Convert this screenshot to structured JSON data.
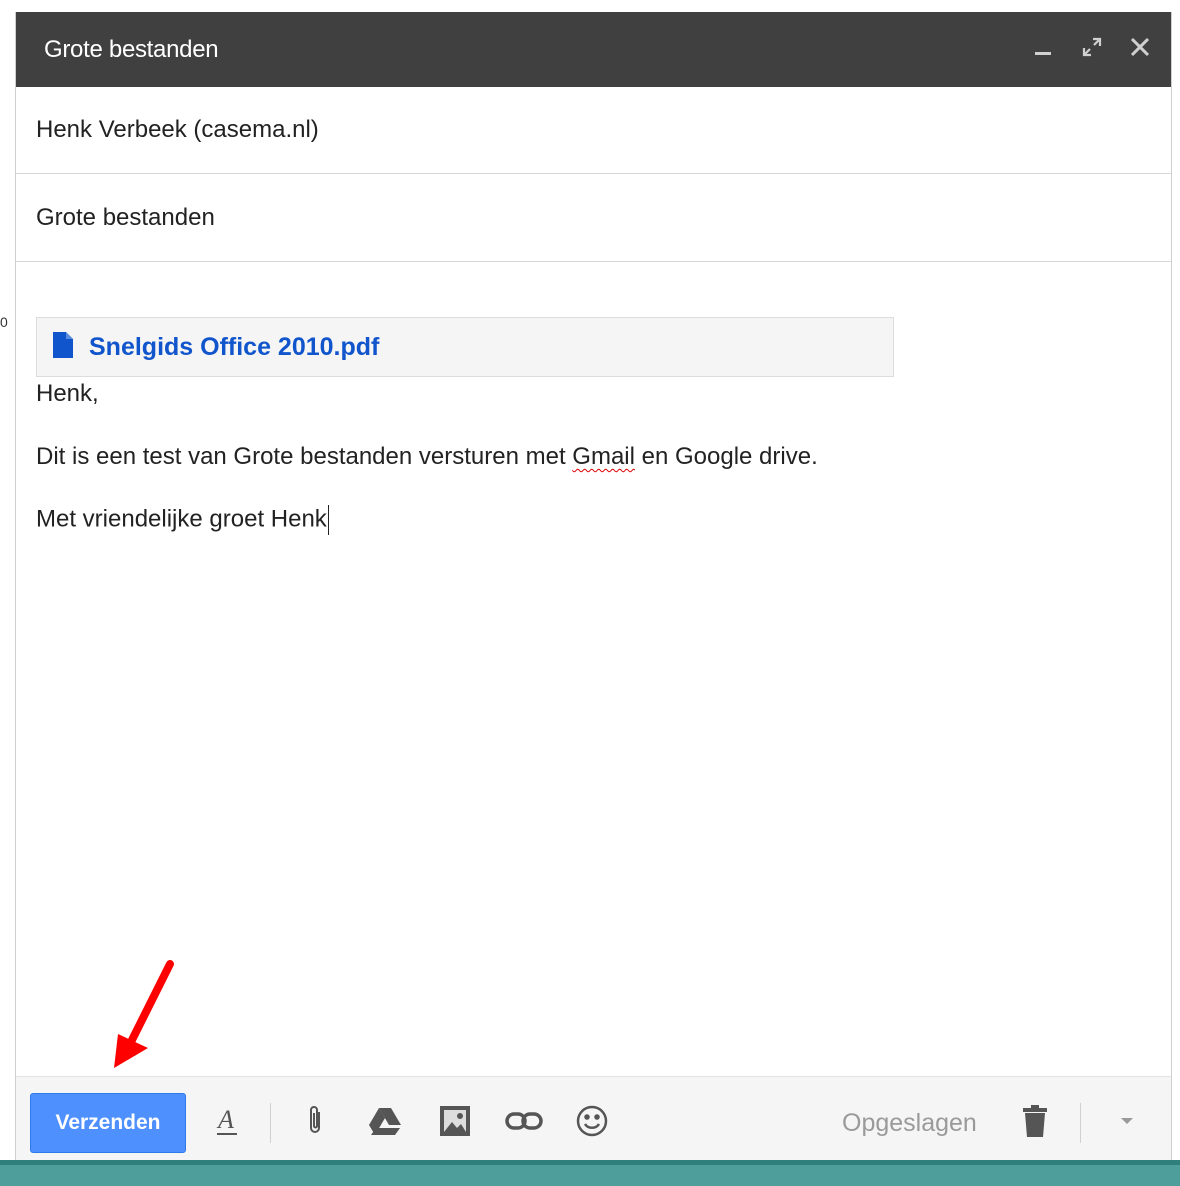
{
  "page": {
    "stray_glyph": "0"
  },
  "window": {
    "title": "Grote bestanden",
    "controls": [
      "minimize-icon",
      "expand-icon",
      "close-icon"
    ]
  },
  "to": {
    "value": "Henk Verbeek (casema.nl)"
  },
  "subject": {
    "value": "Grote bestanden"
  },
  "attachment": {
    "icon": "document-icon",
    "name": "Snelgids Office 2010.pdf"
  },
  "body": {
    "line1": "Henk,",
    "line2_pre": "Dit is een test van Grote bestanden versturen met ",
    "line2_misspelled": "Gmail",
    "line2_post": " en Google drive.",
    "line3": "Met vriendelijke groet Henk"
  },
  "toolbar": {
    "send_label": "Verzenden",
    "tools": [
      "format-text-icon",
      "attach-icon",
      "drive-icon",
      "image-icon",
      "link-icon",
      "emoji-icon"
    ],
    "saved_label": "Opgeslagen",
    "trash": "trash-icon",
    "more": "dropdown-icon"
  },
  "colors": {
    "titlebar": "#404040",
    "send_button": "#4d90fe",
    "attachment_link": "#1155cc",
    "annotation_arrow": "#ff0000",
    "bottom_stripe": "#4e9f9b"
  }
}
